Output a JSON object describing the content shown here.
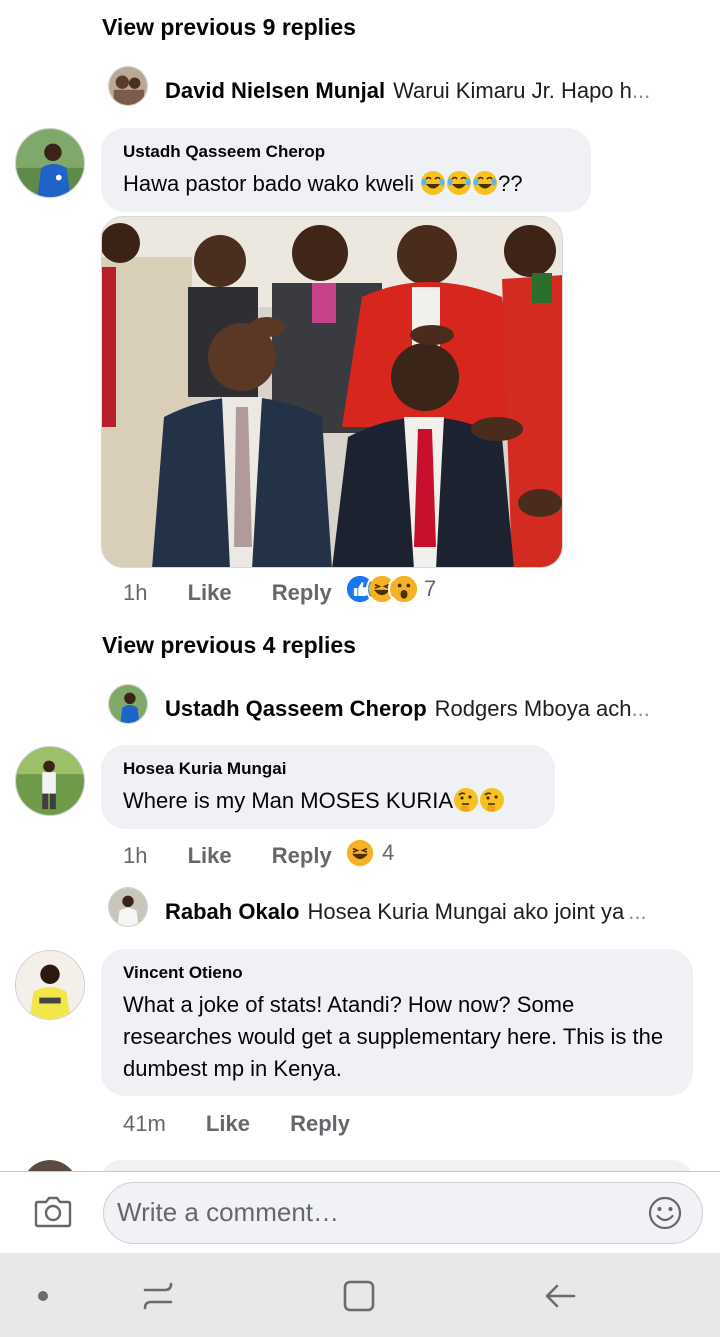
{
  "thread1": {
    "view_previous": "View previous 9 replies",
    "reply": {
      "name": "David Nielsen Munjal",
      "text": "Warui Kimaru Jr. Hapo h",
      "ellipsis": "..."
    }
  },
  "comment1": {
    "name": "Ustadh Qasseem Cherop",
    "text": "Hawa pastor bado wako kweli",
    "suffix": "??",
    "time": "1h",
    "like": "Like",
    "reply": "Reply",
    "reaction_count": "7",
    "reactions": [
      "like",
      "haha",
      "wow"
    ]
  },
  "thread2": {
    "view_previous": "View previous 4 replies",
    "reply": {
      "name": "Ustadh Qasseem Cherop",
      "text": "Rodgers Mboya ach",
      "ellipsis": "..."
    }
  },
  "comment2": {
    "name": "Hosea Kuria Mungai",
    "text": "Where is my Man MOSES KURIA",
    "time": "1h",
    "like": "Like",
    "reply": "Reply",
    "reaction_count": "4",
    "reactions": [
      "haha"
    ]
  },
  "thread3": {
    "reply": {
      "name": "Rabah Okalo",
      "text": "Hosea Kuria Mungai ako joint ya",
      "ellipsis": "..."
    }
  },
  "comment3": {
    "name": "Vincent Otieno",
    "text": "What a joke of stats! Atandi? How now? Some researches would get a supplementary here. This is the dumbest mp in Kenya.",
    "time": "41m",
    "like": "Like",
    "reply": "Reply"
  },
  "composer": {
    "placeholder": "Write a comment…"
  },
  "colors": {
    "bubble": "#eff1f4",
    "muted": "#65676b",
    "like_blue": "#1877f2",
    "haha_yellow": "#f7b125"
  },
  "icons": [
    "camera-icon",
    "smiley-icon",
    "nav-dot-icon",
    "recents-icon",
    "home-icon",
    "back-icon"
  ]
}
